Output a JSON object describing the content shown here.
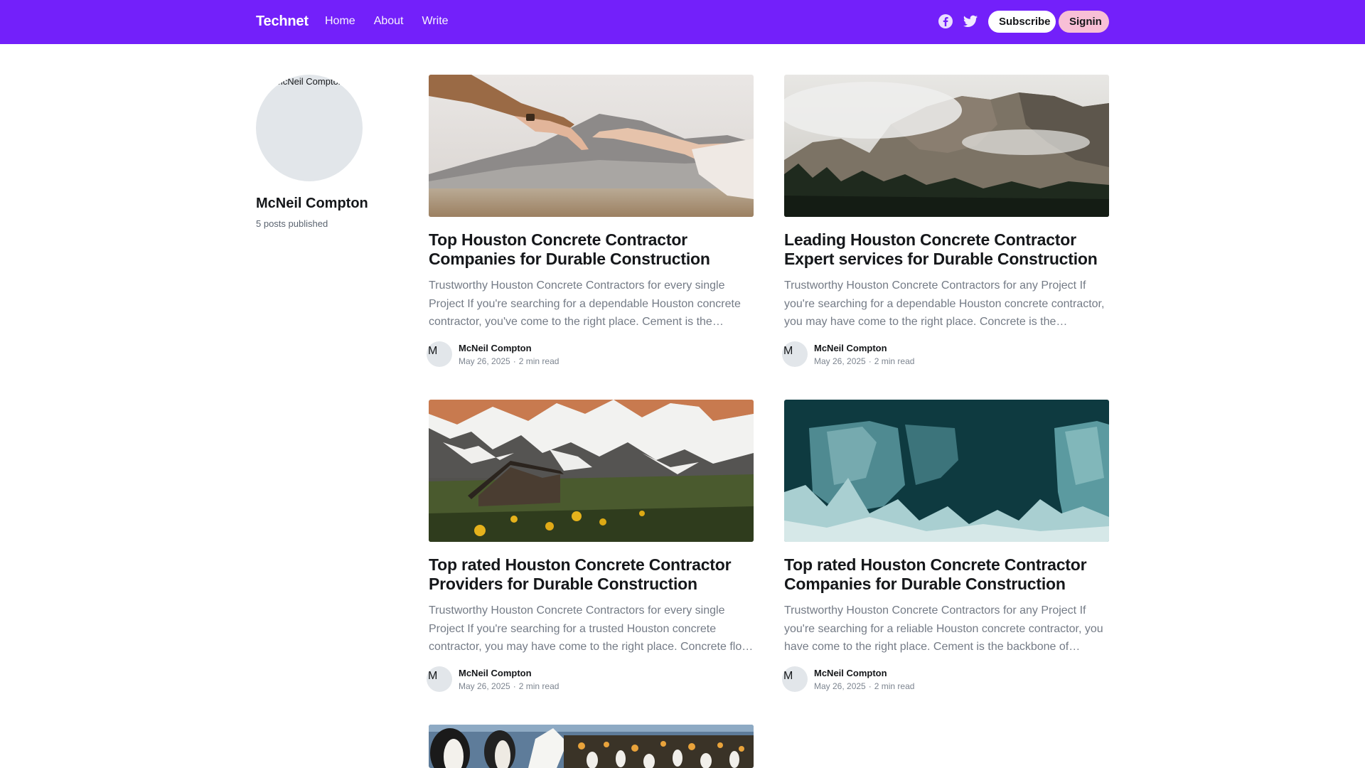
{
  "header": {
    "brand": "Technet",
    "nav": [
      "Home",
      "About",
      "Write"
    ],
    "subscribe_label": "Subscribe",
    "signin_label": "Signin",
    "accent_color": "#7320fa"
  },
  "author": {
    "avatar_alt": "McNeil Compton",
    "name": "McNeil Compton",
    "posts_count": "5 posts published"
  },
  "posts": [
    {
      "image": "hands-touching-mountains",
      "title": "Top Houston Concrete Contractor Companies for Durable Construction",
      "excerpt": "Trustworthy Houston Concrete Contractors for every single Project If you're searching for a dependable Houston concrete contractor, you've come to the right place. Cement is the…",
      "author_avatar_alt": "M",
      "author": "McNeil Compton",
      "date": "May 26, 2025",
      "read_time": "2 min read"
    },
    {
      "image": "misty-mountain-forest",
      "title": "Leading Houston Concrete Contractor Expert services for Durable Construction",
      "excerpt": "Trustworthy Houston Concrete Contractors for any Project If you're searching for a dependable Houston concrete contractor, you may have come to the right place. Concrete is the backbon…",
      "author_avatar_alt": "M",
      "author": "McNeil Compton",
      "date": "May 26, 2025",
      "read_time": "2 min read"
    },
    {
      "image": "cabin-snowy-mountains",
      "title": "Top rated Houston Concrete Contractor Providers for Durable Construction",
      "excerpt": "Trustworthy Houston Concrete Contractors for every single Project If you're searching for a trusted Houston concrete contractor, you may have come to the right place. Concrete flo…",
      "author_avatar_alt": "M",
      "author": "McNeil Compton",
      "date": "May 26, 2025",
      "read_time": "2 min read"
    },
    {
      "image": "glacier-ice-wall",
      "title": "Top rated Houston Concrete Contractor Companies for Durable Construction",
      "excerpt": "Trustworthy Houston Concrete Contractors for any Project If you're searching for a reliable Houston concrete contractor, you have come to the right place. Cement is the backbone of…",
      "author_avatar_alt": "M",
      "author": "McNeil Compton",
      "date": "May 26, 2025",
      "read_time": "2 min read"
    },
    {
      "image": "penguin-colony"
    }
  ]
}
